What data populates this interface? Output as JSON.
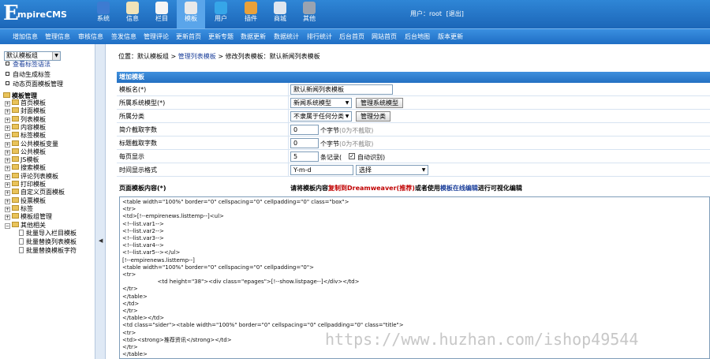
{
  "header": {
    "logo_big": "E",
    "logo_rest": "mpireCMS",
    "modules": [
      {
        "label": "系统",
        "icon": "system-icon",
        "color": "#3d7bd1"
      },
      {
        "label": "信息",
        "icon": "info-icon",
        "color": "#f0e3b8"
      },
      {
        "label": "栏目",
        "icon": "folder-icon",
        "color": "#f5f5f5"
      },
      {
        "label": "模板",
        "icon": "template-icon",
        "color": "#e9e9e9"
      },
      {
        "label": "用户",
        "icon": "user-icon",
        "color": "#36a6e8"
      },
      {
        "label": "插件",
        "icon": "plugin-icon",
        "color": "#e9a13a"
      },
      {
        "label": "商城",
        "icon": "shop-icon",
        "color": "#dfe6ef"
      },
      {
        "label": "其他",
        "icon": "gear-icon",
        "color": "#9aa3b0"
      }
    ],
    "active_module": "模板",
    "user_label": "用户：",
    "user_name": "root",
    "logout": "[退出]"
  },
  "subnav": [
    "增加信息",
    "管理信息",
    "审核信息",
    "签发信息",
    "管理评论",
    "更新首页",
    "更新专题",
    "数据更新",
    "数据统计",
    "排行统计",
    "后台首页",
    "网站首页",
    "后台地图",
    "版本更新"
  ],
  "sidebar": {
    "group_select": "默认模板组",
    "links": [
      "查看标签语法",
      "自动生成标签",
      "动态页面模板管理"
    ],
    "tree_root": "模板管理",
    "tree_items": [
      "首页模板",
      "封面模板",
      "列表模板",
      "内容模板",
      "标签模板",
      "公共模板变量",
      "公共模板",
      "JS模板",
      "搜索模板",
      "评论列表模板",
      "打印模板",
      "自定义页面模板",
      "投票模板",
      "标签",
      "模板组管理",
      "其他相关"
    ],
    "tree_children": [
      "批量导入栏目模板",
      "批量替换列表模板",
      "批量替换模板字符"
    ]
  },
  "main": {
    "breadcrumb_prefix": "位置：默认模板组 > ",
    "breadcrumb_link": "管理列表模板",
    "breadcrumb_suffix": " > 修改列表模板：默认新闻列表模板",
    "form_title": "增加模板",
    "fields": {
      "name_label": "模板名(*)",
      "name_value": "默认新闻列表模板",
      "model_label": "所属系统模型(*)",
      "model_value": "新闻系统模型",
      "model_button": "管理系统模型",
      "category_label": "所属分类",
      "category_value": "不隶属于任何分类",
      "category_button": "管理分类",
      "intro_label": "简介截取字数",
      "intro_value": "0",
      "intro_hint": "个字节",
      "intro_hint_gray": "(0为不截取)",
      "title_cut_label": "标题截取字数",
      "title_cut_value": "0",
      "title_cut_hint": "个字节",
      "title_cut_hint_gray": "(0为不截取)",
      "per_page_label": "每页显示",
      "per_page_value": "5",
      "per_page_hint": "条记录(",
      "auto_detect": "自动识别)",
      "time_label": "时间显示格式",
      "time_value": "Y-m-d",
      "time_select": "选择",
      "content_label": "页面模板内容(*)",
      "content_hint_a": "请将模板内容",
      "content_hint_b": "复制到Dreamweaver(推荐)",
      "content_hint_c": "或者使用",
      "content_hint_d": "模板在线编辑",
      "content_hint_e": "进行可视化编辑"
    },
    "code_lines": [
      "<table width=\"100%\" border=\"0\" cellspacing=\"0\" cellpadding=\"0\" class=\"box\">",
      "<tr>",
      "<td>[!--empirenews.listtemp--]<ul>",
      "<!--list.var1-->",
      "<!--list.var2-->",
      "<!--list.var3-->",
      "<!--list.var4-->",
      "<!--list.var5--></ul>",
      "[!--empirenews.listtemp--]",
      "<table width=\"100%\" border=\"0\" cellspacing=\"0\" cellpadding=\"0\">",
      "<tr>",
      "                    <td height=\"38\"><div class=\"epages\">[!--show.listpage--]</div></td>",
      "</tr>",
      "</table>",
      "</td>",
      "</tr>",
      "</table></td>",
      "<td class=\"sider\"><table width=\"100%\" border=\"0\" cellspacing=\"0\" cellpadding=\"0\" class=\"title\">",
      "<tr>",
      "<td><strong>推荐资讯</strong></td>",
      "</tr>",
      "</table>"
    ],
    "watermark": "https://www.huzhan.com/ishop49544"
  }
}
